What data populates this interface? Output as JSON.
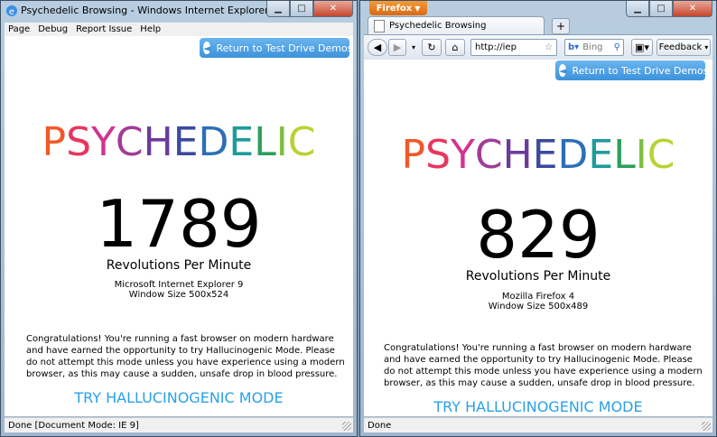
{
  "ie": {
    "title": "Psychedelic Browsing - Windows Internet Explorer Platform Previ...",
    "menu": [
      "Page",
      "Debug",
      "Report Issue",
      "Help"
    ],
    "return_label": "Return to Test Drive Demos",
    "psychedelic": [
      "P",
      "S",
      "Y",
      "C",
      "H",
      "E",
      "D",
      "E",
      "L",
      "I",
      "C"
    ],
    "rpm": "1789",
    "rpm_label": "Revolutions Per Minute",
    "browser": "Microsoft Internet Explorer 9",
    "window_size": "Window Size 500x524",
    "congrats": "Congratulations! You're running a fast browser on modern hardware and have earned the opportunity to try Hallucinogenic Mode. Please do not attempt this mode unless you have experience using a modern browser, as this may cause a sudden, unsafe drop in blood pressure.",
    "try_label": "TRY HALLUCINOGENIC MODE",
    "status": "Done [Document Mode: IE 9]"
  },
  "ff": {
    "app_button": "Firefox",
    "tab_title": "Psychedelic Browsing",
    "url": "http://iep",
    "search_placeholder": "Bing",
    "feedback_label": "Feedback",
    "return_label": "Return to Test Drive Demos",
    "psychedelic": [
      "P",
      "S",
      "Y",
      "C",
      "H",
      "E",
      "D",
      "E",
      "L",
      "I",
      "C"
    ],
    "rpm": "829",
    "rpm_label": "Revolutions Per Minute",
    "browser": "Mozilla Firefox 4",
    "window_size": "Window Size 500x489",
    "congrats": "Congratulations! You're running a fast browser on modern hardware and have earned the opportunity to try Hallucinogenic Mode. Please do not attempt this mode unless you have experience using a modern browser, as this may cause a sudden, unsafe drop in blood pressure.",
    "try_label": "TRY HALLUCINOGENIC MODE",
    "status": "Done"
  },
  "letter_colors": [
    "#f05a28",
    "#e8365d",
    "#d2348f",
    "#a23c98",
    "#6b3b9b",
    "#3c4a9e",
    "#2c6fb6",
    "#1f9b9b",
    "#2ca05a",
    "#7bbf3e",
    "#b7d334"
  ],
  "icons": {
    "ie_logo": "ie-logo-icon",
    "return": "arrow-left-circle-icon",
    "back": "back-arrow-icon",
    "forward": "forward-arrow-icon",
    "reload": "reload-icon",
    "home": "home-icon",
    "star": "star-icon",
    "search": "search-icon"
  }
}
